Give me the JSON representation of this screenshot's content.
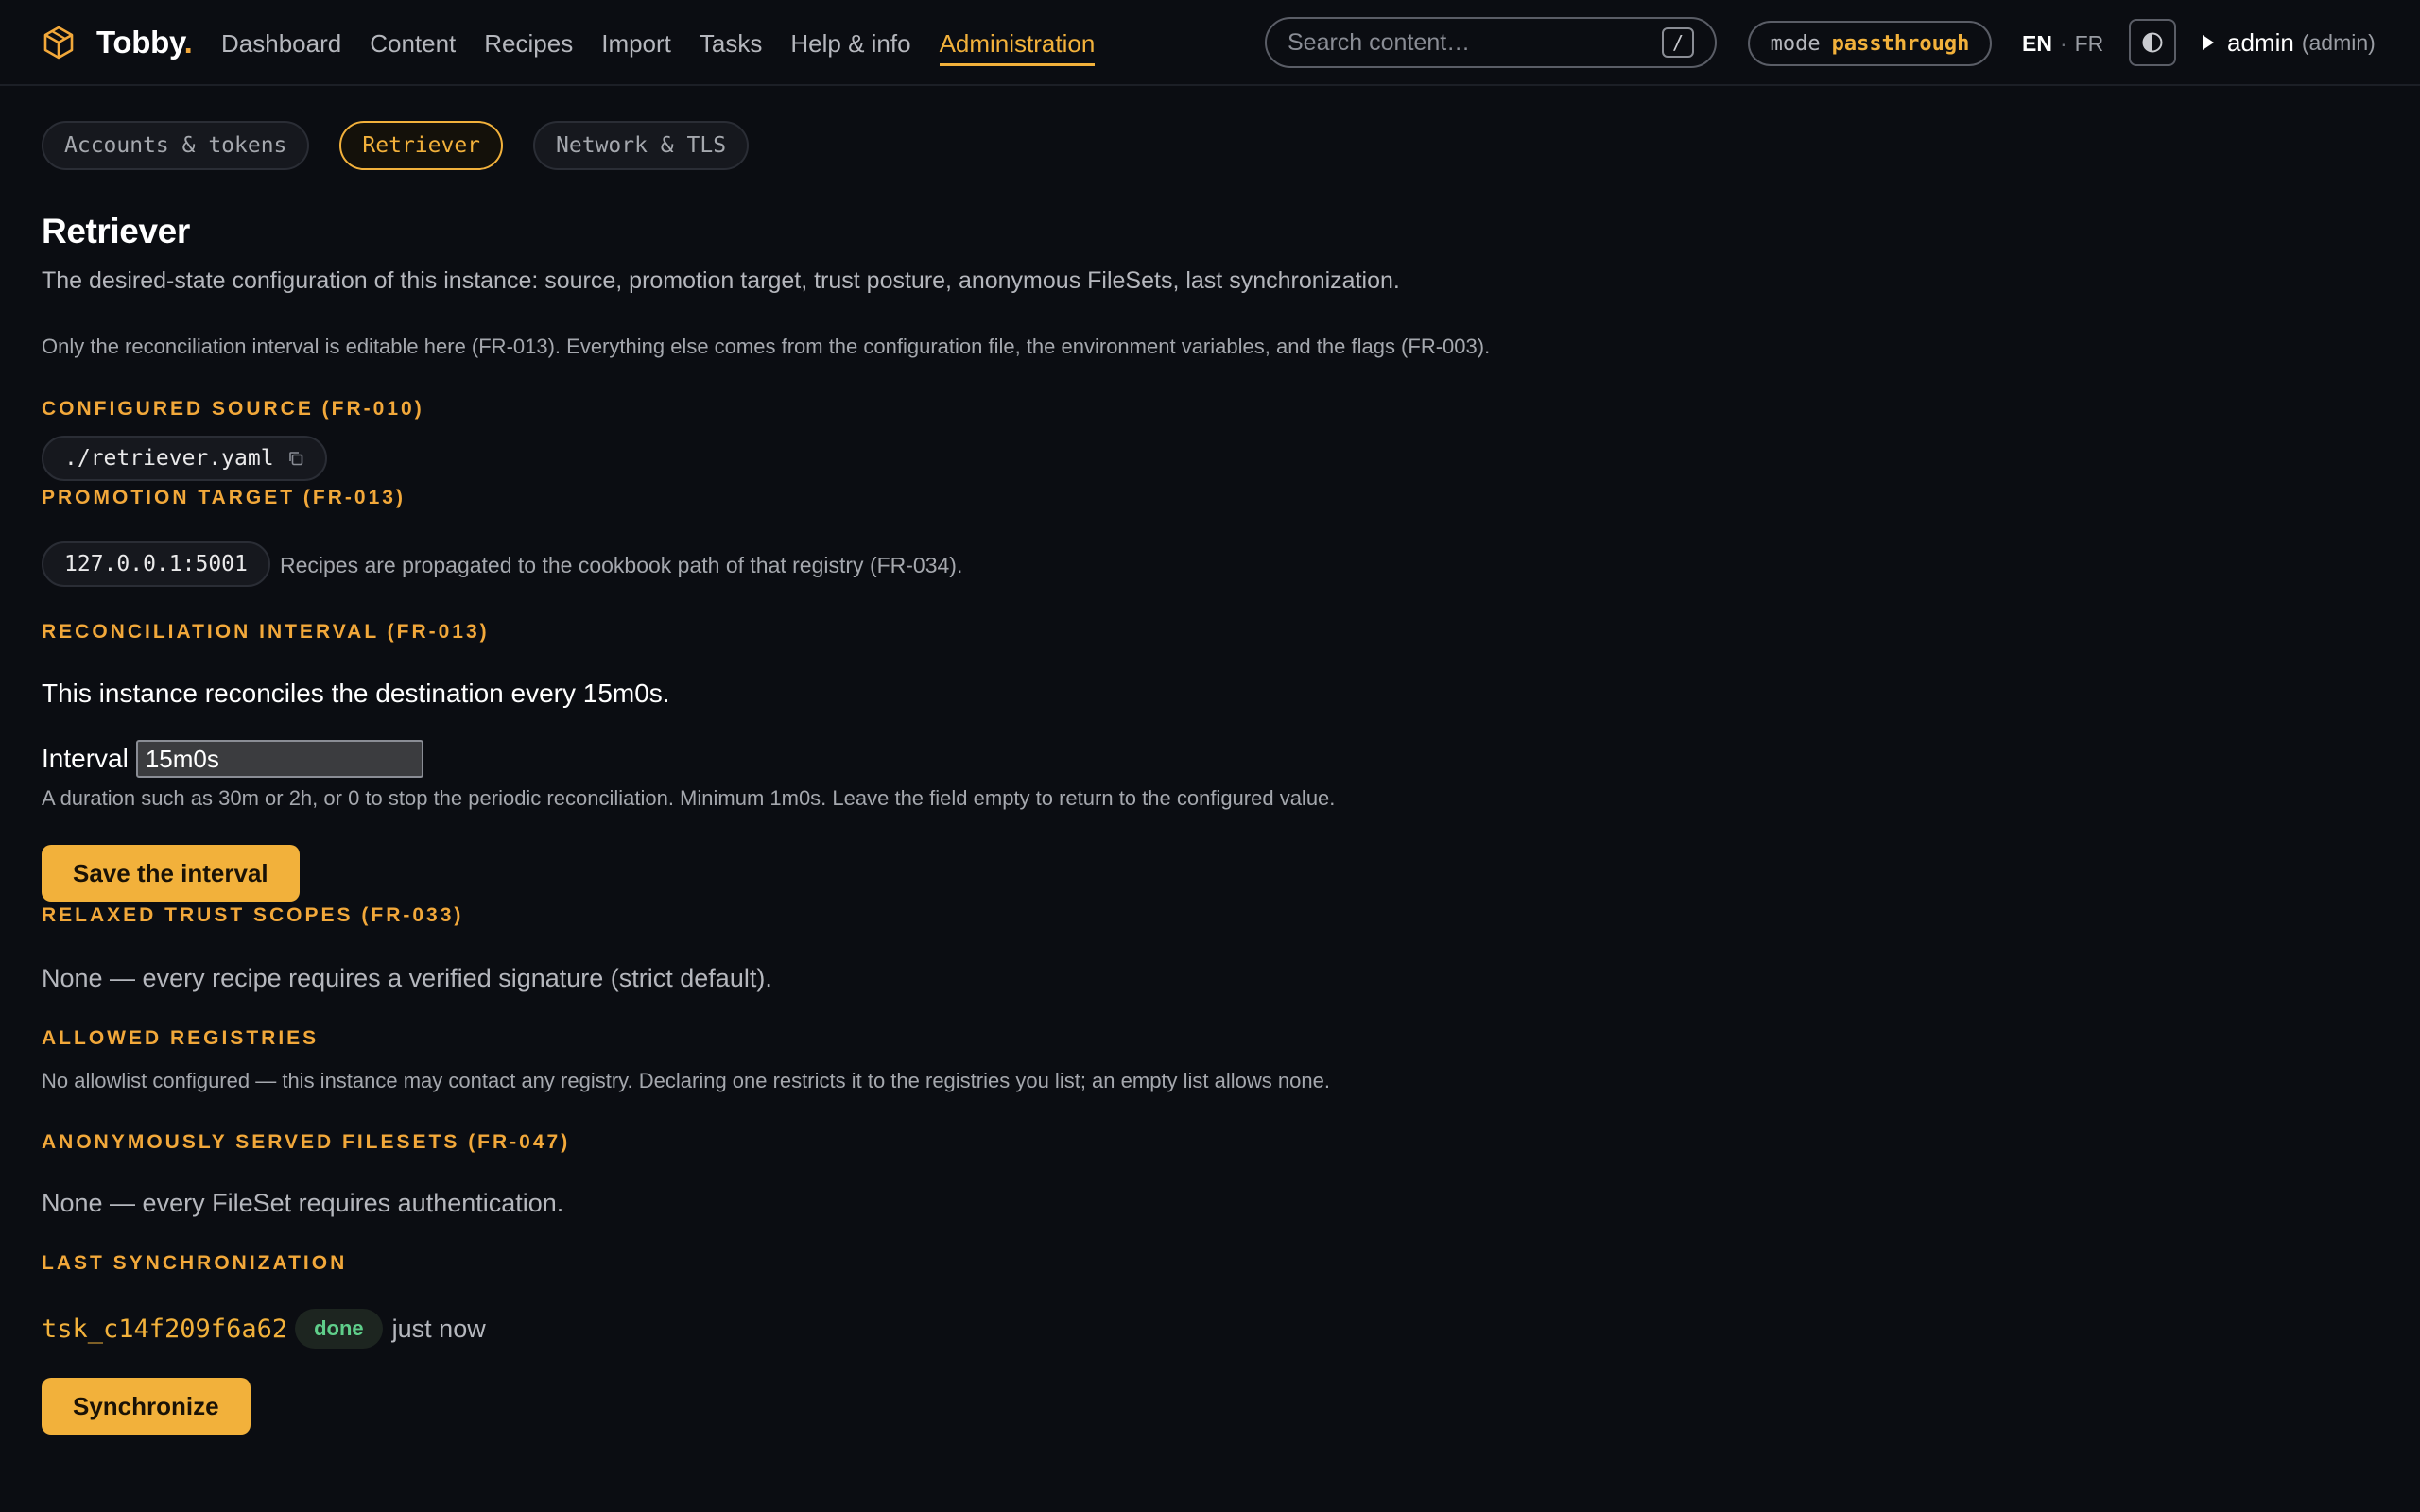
{
  "brand": {
    "name": "Tobby",
    "dot": ".",
    "accent": "#f2a83a"
  },
  "nav": [
    {
      "label": "Dashboard",
      "active": false
    },
    {
      "label": "Content",
      "active": false
    },
    {
      "label": "Recipes",
      "active": false
    },
    {
      "label": "Import",
      "active": false
    },
    {
      "label": "Tasks",
      "active": false
    },
    {
      "label": "Help & info",
      "active": false
    },
    {
      "label": "Administration",
      "active": true
    }
  ],
  "search": {
    "placeholder": "Search content…",
    "shortcut": "/"
  },
  "mode": {
    "label": "mode",
    "value": "passthrough"
  },
  "lang": {
    "en": "EN",
    "sep": "·",
    "fr": "FR"
  },
  "user": {
    "name": "admin",
    "role": "(admin)"
  },
  "subtabs": [
    {
      "label": "Accounts & tokens",
      "active": false
    },
    {
      "label": "Retriever",
      "active": true
    },
    {
      "label": "Network & TLS",
      "active": false
    }
  ],
  "page": {
    "title": "Retriever",
    "lede": "The desired-state configuration of this instance: source, promotion target, trust posture, anonymous FileSets, last synchronization.",
    "note": "Only the reconciliation interval is editable here (FR-013). Everything else comes from the configuration file, the environment variables, and the flags (FR-003)."
  },
  "source": {
    "heading": "Configured source (FR-010)",
    "value": "./retriever.yaml"
  },
  "promotion": {
    "heading": "Promotion target (FR-013)",
    "value": "127.0.0.1:5001",
    "note": "Recipes are propagated to the cookbook path of that registry (FR-034)."
  },
  "reconciliation": {
    "heading": "Reconciliation interval (FR-013)",
    "summary": "This instance reconciles the destination every 15m0s.",
    "label": "Interval",
    "value": "15m0s",
    "help": "A duration such as 30m or 2h, or 0 to stop the periodic reconciliation. Minimum 1m0s. Leave the field empty to return to the configured value.",
    "save_label": "Save the interval"
  },
  "trust": {
    "heading": "Relaxed trust scopes (FR-033)",
    "text": "None — every recipe requires a verified signature (strict default)."
  },
  "registries": {
    "heading": "Allowed registries",
    "text": "No allowlist configured — this instance may contact any registry. Declaring one restricts it to the registries you list; an empty list allows none."
  },
  "anonymous": {
    "heading": "Anonymously served FileSets (FR-047)",
    "text": "None — every FileSet requires authentication."
  },
  "sync": {
    "heading": "Last synchronization",
    "task_id": "tsk_c14f209f6a62",
    "status": "done",
    "when": "just now",
    "button_label": "Synchronize"
  }
}
